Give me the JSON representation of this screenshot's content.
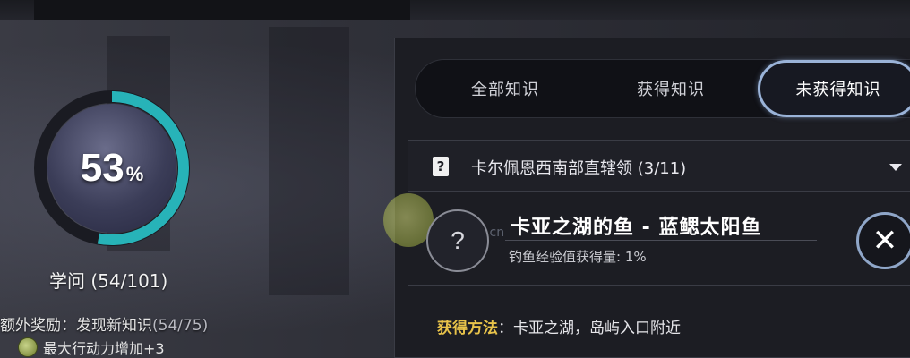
{
  "progress": {
    "percent_value": "53",
    "percent_unit": "%",
    "fill_fraction": 0.53,
    "ring_color": "#27b3b8"
  },
  "knowledge": {
    "label": "学问 (54/101)"
  },
  "bonus": {
    "text": "额外奖励：发现新知识",
    "count": "(54/75)",
    "reward_text": "最大行动力增加+3"
  },
  "tabs": {
    "all": "全部知识",
    "obtained": "获得知识",
    "not_obtained": "未获得知识"
  },
  "region": {
    "title": "卡尔佩恩西南部直辖领 (3/11)",
    "icon": "book-question-icon"
  },
  "item": {
    "icon_glyph": "?",
    "title": "卡亚之湖的鱼 - 蓝鳃太阳鱼",
    "subtitle": "钓鱼经验值获得量: 1%",
    "close_glyph": "✕"
  },
  "method": {
    "label": "获得方法",
    "separator": "：",
    "value": "卡亚之湖，岛屿入口附近"
  },
  "watermark": {
    "text": "doyo.cn"
  },
  "colors": {
    "accent_tab_border": "#9ab3d8",
    "method_label": "#e8c34a"
  }
}
